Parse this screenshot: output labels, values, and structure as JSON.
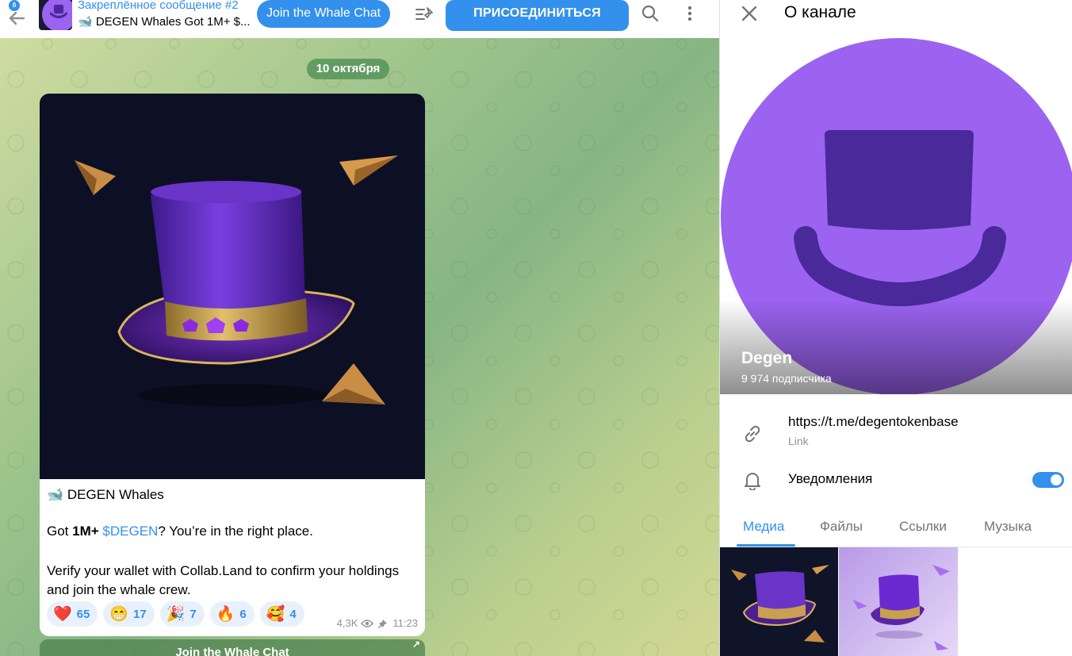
{
  "chat": {
    "pinned": {
      "title": "Закреплённое сообщение #2",
      "text": "🐋 DEGEN Whales Got 1M+ $..."
    },
    "header_buttons": {
      "join_whale_chat": "Join the Whale Chat",
      "join": "ПРИСОЕДИНИТЬСЯ"
    },
    "date": "10 октября",
    "message": {
      "heading_emoji": "🐋",
      "heading": "DEGEN Whales",
      "line1_pre": "Got ",
      "line1_bold": "1M+",
      "line1_tag": "$DEGEN",
      "line1_post": "? You’re in the right place.",
      "line2": "Verify your wallet with Collab.Land to confirm your holdings and join the whale crew.",
      "reactions": [
        {
          "emoji": "❤️",
          "count": "65"
        },
        {
          "emoji": "😁",
          "count": "17"
        },
        {
          "emoji": "🎉",
          "count": "7"
        },
        {
          "emoji": "🔥",
          "count": "6"
        },
        {
          "emoji": "🥰",
          "count": "4"
        }
      ],
      "views": "4,3K",
      "time": "11:23"
    },
    "bottom_button": "Join the Whale Chat"
  },
  "panel": {
    "title": "О канале",
    "channel_name": "Degen",
    "subscribers": "9 974 подписчика",
    "link": {
      "value": "https://t.me/degentokenbase",
      "caption": "Link"
    },
    "notifications": {
      "label": "Уведомления",
      "enabled": true
    },
    "tabs": [
      "Медиа",
      "Файлы",
      "Ссылки",
      "Музыка"
    ],
    "active_tab": "Медиа"
  },
  "colors": {
    "accent": "#3390ec",
    "avatar_purple": "#9b63f0",
    "hat_dark": "#4a2a9a"
  }
}
